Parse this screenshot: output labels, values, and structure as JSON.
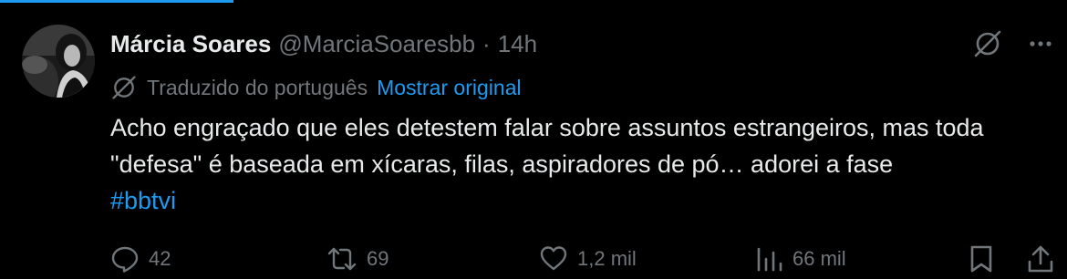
{
  "tweet": {
    "author": {
      "display_name": "Márcia Soares",
      "handle": "@MarciaSoaresbb",
      "separator": "·",
      "time": "14h"
    },
    "translation": {
      "label": "Traduzido do português",
      "show_original": "Mostrar original"
    },
    "body": {
      "text": "Acho engraçado que eles detestem falar sobre assuntos estrangeiros, mas toda \"defesa\" é baseada em xícaras, filas, aspiradores de pó… adorei a fase",
      "hashtag": "#bbtvi"
    },
    "stats": {
      "replies": "42",
      "retweets": "69",
      "likes": "1,2 mil",
      "views": "66 mil"
    },
    "icons": {
      "grok": "grok-icon",
      "more": "more-icon",
      "translate": "translate-icon",
      "reply": "reply-icon",
      "retweet": "retweet-icon",
      "like": "heart-icon",
      "views": "views-icon",
      "bookmark": "bookmark-icon",
      "share": "share-icon"
    },
    "colors": {
      "background": "#000000",
      "text": "#e7e9ea",
      "muted": "#71767b",
      "accent": "#1d9bf0"
    }
  }
}
